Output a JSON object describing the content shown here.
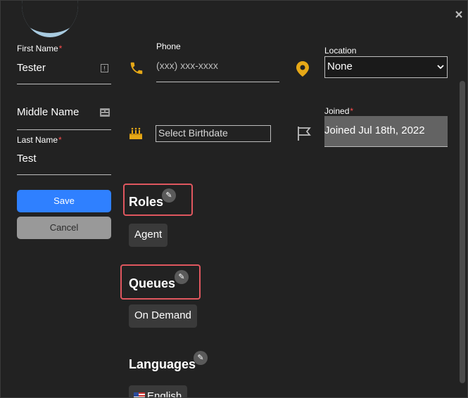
{
  "close_icon": "×",
  "first_name": {
    "label": "First Name",
    "required": "*",
    "value": "Tester"
  },
  "middle_name": {
    "placeholder": "Middle Name"
  },
  "last_name": {
    "label": "Last Name",
    "required": "*",
    "value": "Test"
  },
  "buttons": {
    "save": "Save",
    "cancel": "Cancel"
  },
  "phone": {
    "label": "Phone",
    "placeholder": "(xxx) xxx-xxxx"
  },
  "location": {
    "label": "Location",
    "value": "None"
  },
  "birthdate": {
    "placeholder": "Select Birthdate"
  },
  "joined": {
    "label": "Joined",
    "required": "*",
    "value": "Joined Jul 18th, 2022"
  },
  "roles": {
    "title": "Roles",
    "chips": [
      "Agent"
    ]
  },
  "queues": {
    "title": "Queues",
    "chips": [
      "On Demand"
    ]
  },
  "languages": {
    "title": "Languages",
    "chips": [
      "English"
    ]
  },
  "colors": {
    "accent_gold": "#e6a817",
    "primary_blue": "#2f80ff",
    "highlight_red": "#e0575f"
  }
}
